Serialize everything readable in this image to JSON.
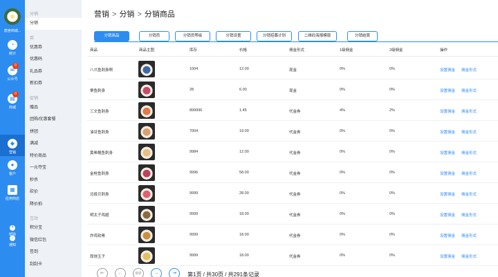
{
  "rail": {
    "store_name": "唐宫商城...",
    "items": [
      {
        "label": "统计",
        "icon": "◔",
        "icon_name": "clock-icon",
        "badge": ""
      },
      {
        "label": "公众号",
        "icon": "✉",
        "icon_name": "chat-icon",
        "badge": "0"
      },
      {
        "label": "商城",
        "icon": "▤",
        "icon_name": "cart-icon",
        "badge": "0"
      },
      {
        "label": "营销",
        "icon": "◆",
        "icon_name": "tag-icon",
        "badge": ""
      },
      {
        "label": "客户",
        "icon": "●",
        "icon_name": "users-icon",
        "badge": ""
      },
      {
        "label": "应用商店",
        "icon": "▦",
        "icon_name": "apps-grid-icon",
        "badge": ""
      }
    ],
    "help_label": "帮助",
    "notify_label": "通知"
  },
  "submenu": {
    "groups": [
      {
        "title": "分销",
        "items": [
          "分销"
        ]
      },
      {
        "title": "券",
        "items": [
          "优惠券",
          "优惠码",
          "礼品券",
          "新扣券"
        ]
      },
      {
        "title": "促销",
        "items": [
          "赠品",
          "团购/优惠套餐",
          "拼团",
          "满减",
          "特价商品",
          "一元夺宝",
          "秒杀",
          "砍价",
          "降价拍"
        ]
      },
      {
        "title": "互动",
        "items": [
          "积分宝",
          "微信红包",
          "签到",
          "刮刮卡"
        ]
      }
    ]
  },
  "breadcrumb": [
    "营销",
    "分销",
    "分销商品"
  ],
  "breadcrumb_sep": ">",
  "tabs": [
    "分销商品",
    "分销员",
    "分销员等级",
    "分销设置",
    "分销招募计划",
    "二维码海报模版",
    "分销结算"
  ],
  "table": {
    "headers": [
      "商品",
      "商品主图",
      "库存",
      "价格",
      "佣金形式",
      "1级佣金",
      "2级佣金",
      "操作"
    ],
    "op_labels": [
      "设置佣金",
      "佣金形式"
    ],
    "rows": [
      {
        "name": "八爪鱼刺身啊",
        "stock": "1004",
        "price": "12.00",
        "type": "现金",
        "l1": "0%",
        "l2": "0%",
        "img": "#3a6aa8"
      },
      {
        "name": "栗鱼刺身",
        "stock": "28",
        "price": "6.00",
        "type": "现金",
        "l1": "0%",
        "l2": "0%",
        "img": "#c84a6a"
      },
      {
        "name": "三文鱼刺身",
        "stock": "899996",
        "price": "1.45",
        "type": "代金券",
        "l1": "4%",
        "l2": "2%",
        "img": "#e07a4a"
      },
      {
        "name": "油甘鱼刺身",
        "stock": "7004",
        "price": "19.00",
        "type": "代金券",
        "l1": "0%",
        "l2": "0%",
        "img": "#d9a070"
      },
      {
        "name": "黄希鲲鱼刺身",
        "stock": "9984",
        "price": "12.00",
        "type": "代金券",
        "l1": "0%",
        "l2": "0%",
        "img": "#e8c080"
      },
      {
        "name": "金枪鱼刺身",
        "stock": "9996",
        "price": "58.00",
        "type": "代金券",
        "l1": "0%",
        "l2": "0%",
        "img": "#c0405a"
      },
      {
        "name": "北极贝刺身",
        "stock": "9999",
        "price": "28.00",
        "type": "代金券",
        "l1": "0%",
        "l2": "0%",
        "img": "#e06070"
      },
      {
        "name": "明太子鸡翅",
        "stock": "9999",
        "price": "18.00",
        "type": "代金券",
        "l1": "0%",
        "l2": "0%",
        "img": "#8a6a40"
      },
      {
        "name": "炸鸡软骨",
        "stock": "9999",
        "price": "18.00",
        "type": "代金券",
        "l1": "0%",
        "l2": "0%",
        "img": "#c89040"
      },
      {
        "name": "厚烧玉子",
        "stock": "9999",
        "price": "18.00",
        "type": "代金券",
        "l1": "0%",
        "l2": "0%",
        "img": "#e0c060"
      }
    ]
  },
  "pager": {
    "first": "⇤",
    "prev": "←",
    "jump": "跳转",
    "next": "→",
    "last": "⇥",
    "info": "第1页 / 共30页 / 共291条记录"
  },
  "colors": {
    "primary": "#2d8cf0",
    "rail": "#2d8cf0",
    "badge": "#ed3f14"
  }
}
